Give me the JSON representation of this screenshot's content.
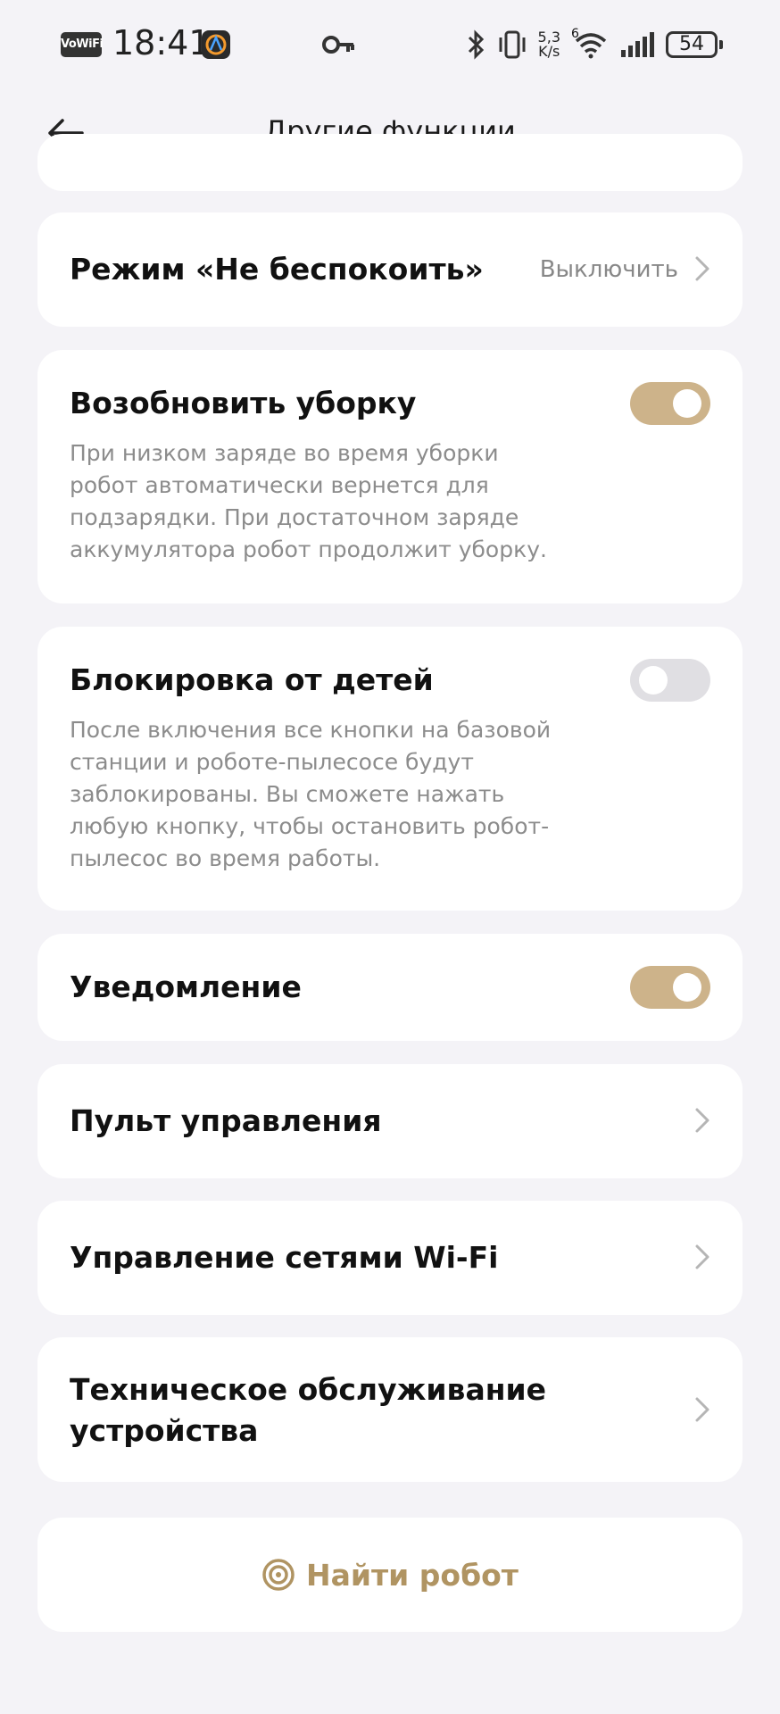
{
  "status_bar": {
    "vowifi": "VoWiFi",
    "time": "18:41",
    "speed_value": "5,3",
    "speed_unit": "K/s",
    "network": "6",
    "battery": "54"
  },
  "header": {
    "title": "Другие функции"
  },
  "settings": {
    "dnd": {
      "label": "Режим «Не беспокоить»",
      "value": "Выключить"
    },
    "resume_cleaning": {
      "label": "Возобновить уборку",
      "enabled": true,
      "description": "При низком заряде во время уборки робот автоматически вернется для подзарядки. При достаточном заряде аккумулятора робот продолжит уборку."
    },
    "child_lock": {
      "label": "Блокировка от детей",
      "enabled": false,
      "description": "После включения все кнопки на базовой станции и роботе-пылесосе будут заблокированы. Вы сможете нажать любую кнопку, чтобы остановить робот-пылесос во время работы."
    },
    "notification": {
      "label": "Уведомление",
      "enabled": true
    },
    "remote": {
      "label": "Пульт управления"
    },
    "wifi": {
      "label": "Управление сетями Wi-Fi"
    },
    "maintenance": {
      "label": "Техническое обслуживание устройства"
    }
  },
  "find_robot": {
    "label": "Найти робот"
  },
  "colors": {
    "accent": "#cdb38a",
    "accent_text": "#b09462",
    "background": "#f4f3f7"
  }
}
